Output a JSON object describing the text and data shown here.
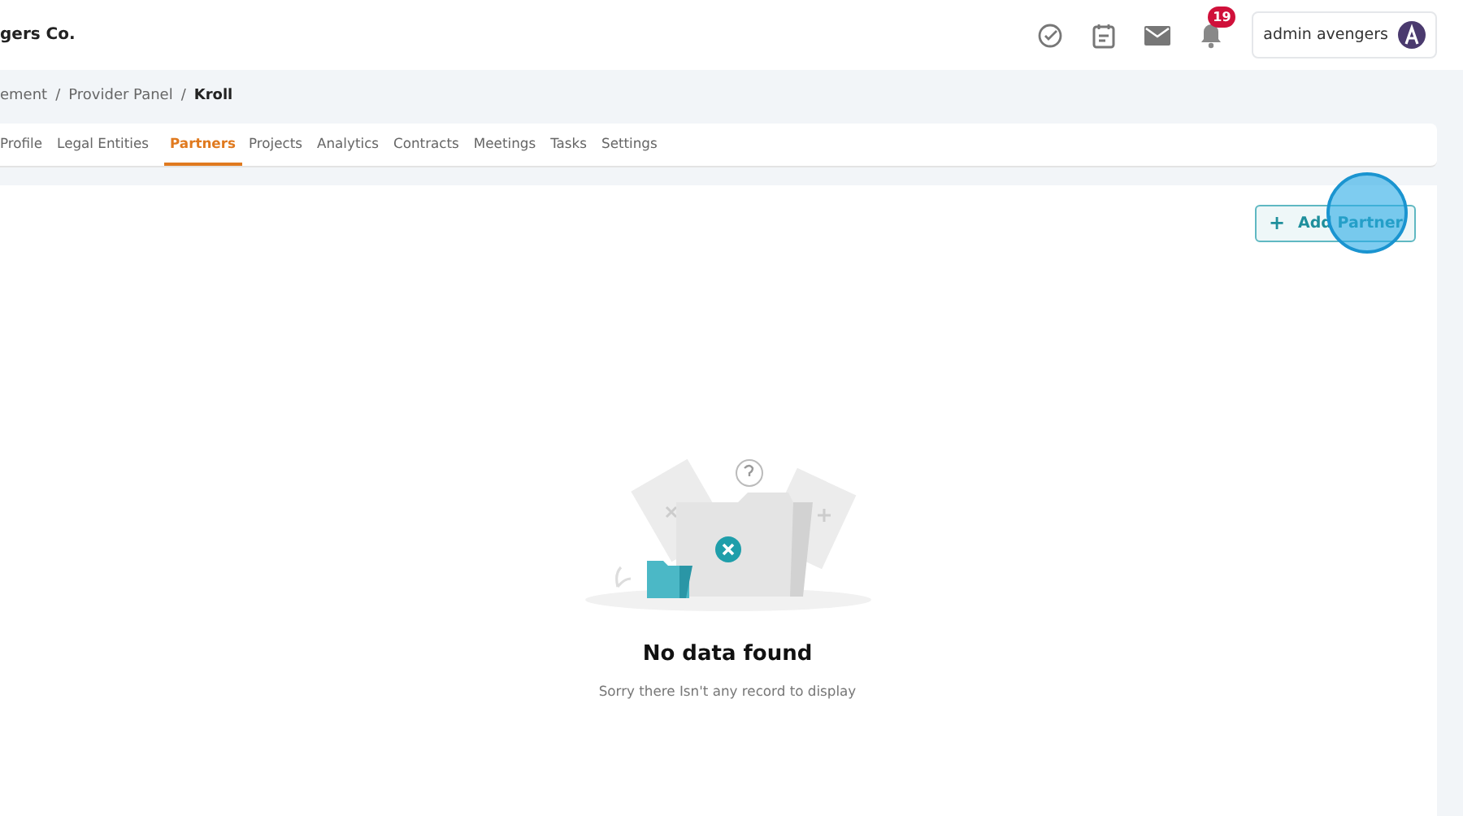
{
  "header": {
    "company": "gers Co.",
    "notification_count": "19",
    "user": {
      "name": "admin avengers"
    }
  },
  "breadcrumb": {
    "separator": "/",
    "items": [
      "ement",
      "Provider Panel",
      "Kroll"
    ]
  },
  "tabs": [
    {
      "label": "Profile",
      "selected": false
    },
    {
      "label": "Legal Entities",
      "selected": false
    },
    {
      "label": "Partners",
      "selected": true
    },
    {
      "label": "Projects",
      "selected": false
    },
    {
      "label": "Analytics",
      "selected": false
    },
    {
      "label": "Contracts",
      "selected": false
    },
    {
      "label": "Meetings",
      "selected": false
    },
    {
      "label": "Tasks",
      "selected": false
    },
    {
      "label": "Settings",
      "selected": false
    }
  ],
  "add_button": {
    "icon": "+",
    "label": "Add Partner"
  },
  "empty_state": {
    "title": "No data found",
    "message": "Sorry there Isn't any record to display"
  }
}
